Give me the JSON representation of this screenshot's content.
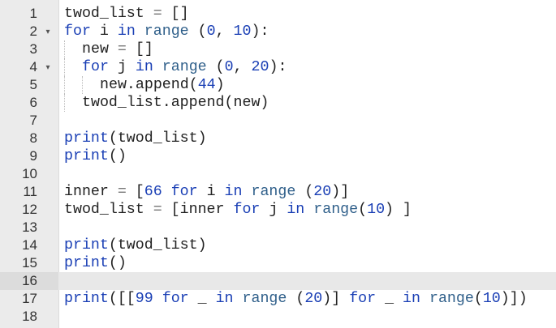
{
  "editor": {
    "fold_marker": "▾",
    "lines": [
      {
        "n": "1",
        "indent": 0,
        "fold": false,
        "tokens": [
          {
            "t": "twod_list ",
            "c": ""
          },
          {
            "t": "=",
            "c": "op"
          },
          {
            "t": " []",
            "c": ""
          }
        ]
      },
      {
        "n": "2",
        "indent": 0,
        "fold": true,
        "tokens": [
          {
            "t": "for",
            "c": "kw"
          },
          {
            "t": " i ",
            "c": ""
          },
          {
            "t": "in",
            "c": "kw"
          },
          {
            "t": " ",
            "c": ""
          },
          {
            "t": "range",
            "c": "rng"
          },
          {
            "t": " (",
            "c": ""
          },
          {
            "t": "0",
            "c": "num"
          },
          {
            "t": ", ",
            "c": ""
          },
          {
            "t": "10",
            "c": "num"
          },
          {
            "t": "):",
            "c": ""
          }
        ]
      },
      {
        "n": "3",
        "indent": 1,
        "fold": false,
        "tokens": [
          {
            "t": "new ",
            "c": ""
          },
          {
            "t": "=",
            "c": "op"
          },
          {
            "t": " []",
            "c": ""
          }
        ]
      },
      {
        "n": "4",
        "indent": 1,
        "fold": true,
        "tokens": [
          {
            "t": "for",
            "c": "kw"
          },
          {
            "t": " j ",
            "c": ""
          },
          {
            "t": "in",
            "c": "kw"
          },
          {
            "t": " ",
            "c": ""
          },
          {
            "t": "range",
            "c": "rng"
          },
          {
            "t": " (",
            "c": ""
          },
          {
            "t": "0",
            "c": "num"
          },
          {
            "t": ", ",
            "c": ""
          },
          {
            "t": "20",
            "c": "num"
          },
          {
            "t": "):",
            "c": ""
          }
        ]
      },
      {
        "n": "5",
        "indent": 2,
        "fold": false,
        "tokens": [
          {
            "t": "new.append(",
            "c": ""
          },
          {
            "t": "44",
            "c": "num"
          },
          {
            "t": ")",
            "c": ""
          }
        ]
      },
      {
        "n": "6",
        "indent": 1,
        "fold": false,
        "tokens": [
          {
            "t": "twod_list.append(new)",
            "c": ""
          }
        ]
      },
      {
        "n": "7",
        "indent": 0,
        "fold": false,
        "tokens": []
      },
      {
        "n": "8",
        "indent": 0,
        "fold": false,
        "tokens": [
          {
            "t": "print",
            "c": "fn"
          },
          {
            "t": "(twod_list)",
            "c": ""
          }
        ]
      },
      {
        "n": "9",
        "indent": 0,
        "fold": false,
        "tokens": [
          {
            "t": "print",
            "c": "fn"
          },
          {
            "t": "()",
            "c": ""
          }
        ]
      },
      {
        "n": "10",
        "indent": 0,
        "fold": false,
        "tokens": []
      },
      {
        "n": "11",
        "indent": 0,
        "fold": false,
        "tokens": [
          {
            "t": "inner ",
            "c": ""
          },
          {
            "t": "=",
            "c": "op"
          },
          {
            "t": " [",
            "c": ""
          },
          {
            "t": "66",
            "c": "num"
          },
          {
            "t": " ",
            "c": ""
          },
          {
            "t": "for",
            "c": "kw"
          },
          {
            "t": " i ",
            "c": ""
          },
          {
            "t": "in",
            "c": "kw"
          },
          {
            "t": " ",
            "c": ""
          },
          {
            "t": "range",
            "c": "rng"
          },
          {
            "t": " (",
            "c": ""
          },
          {
            "t": "20",
            "c": "num"
          },
          {
            "t": ")]",
            "c": ""
          }
        ]
      },
      {
        "n": "12",
        "indent": 0,
        "fold": false,
        "tokens": [
          {
            "t": "twod_list ",
            "c": ""
          },
          {
            "t": "=",
            "c": "op"
          },
          {
            "t": " [inner ",
            "c": ""
          },
          {
            "t": "for",
            "c": "kw"
          },
          {
            "t": " j ",
            "c": ""
          },
          {
            "t": "in",
            "c": "kw"
          },
          {
            "t": " ",
            "c": ""
          },
          {
            "t": "range",
            "c": "rng"
          },
          {
            "t": "(",
            "c": ""
          },
          {
            "t": "10",
            "c": "num"
          },
          {
            "t": ") ]",
            "c": ""
          }
        ]
      },
      {
        "n": "13",
        "indent": 0,
        "fold": false,
        "tokens": []
      },
      {
        "n": "14",
        "indent": 0,
        "fold": false,
        "tokens": [
          {
            "t": "print",
            "c": "fn"
          },
          {
            "t": "(twod_list)",
            "c": ""
          }
        ]
      },
      {
        "n": "15",
        "indent": 0,
        "fold": false,
        "tokens": [
          {
            "t": "print",
            "c": "fn"
          },
          {
            "t": "()",
            "c": ""
          }
        ]
      },
      {
        "n": "16",
        "indent": 0,
        "fold": false,
        "active": true,
        "tokens": []
      },
      {
        "n": "17",
        "indent": 0,
        "fold": false,
        "tokens": [
          {
            "t": "print",
            "c": "fn"
          },
          {
            "t": "([[",
            "c": ""
          },
          {
            "t": "99",
            "c": "num"
          },
          {
            "t": " ",
            "c": ""
          },
          {
            "t": "for",
            "c": "kw"
          },
          {
            "t": " _ ",
            "c": ""
          },
          {
            "t": "in",
            "c": "kw"
          },
          {
            "t": " ",
            "c": ""
          },
          {
            "t": "range",
            "c": "rng"
          },
          {
            "t": " (",
            "c": ""
          },
          {
            "t": "20",
            "c": "num"
          },
          {
            "t": ")] ",
            "c": ""
          },
          {
            "t": "for",
            "c": "kw"
          },
          {
            "t": " _ ",
            "c": ""
          },
          {
            "t": "in",
            "c": "kw"
          },
          {
            "t": " ",
            "c": ""
          },
          {
            "t": "range",
            "c": "rng"
          },
          {
            "t": "(",
            "c": ""
          },
          {
            "t": "10",
            "c": "num"
          },
          {
            "t": ")])",
            "c": ""
          }
        ]
      },
      {
        "n": "18",
        "indent": 0,
        "fold": false,
        "tokens": []
      }
    ]
  }
}
